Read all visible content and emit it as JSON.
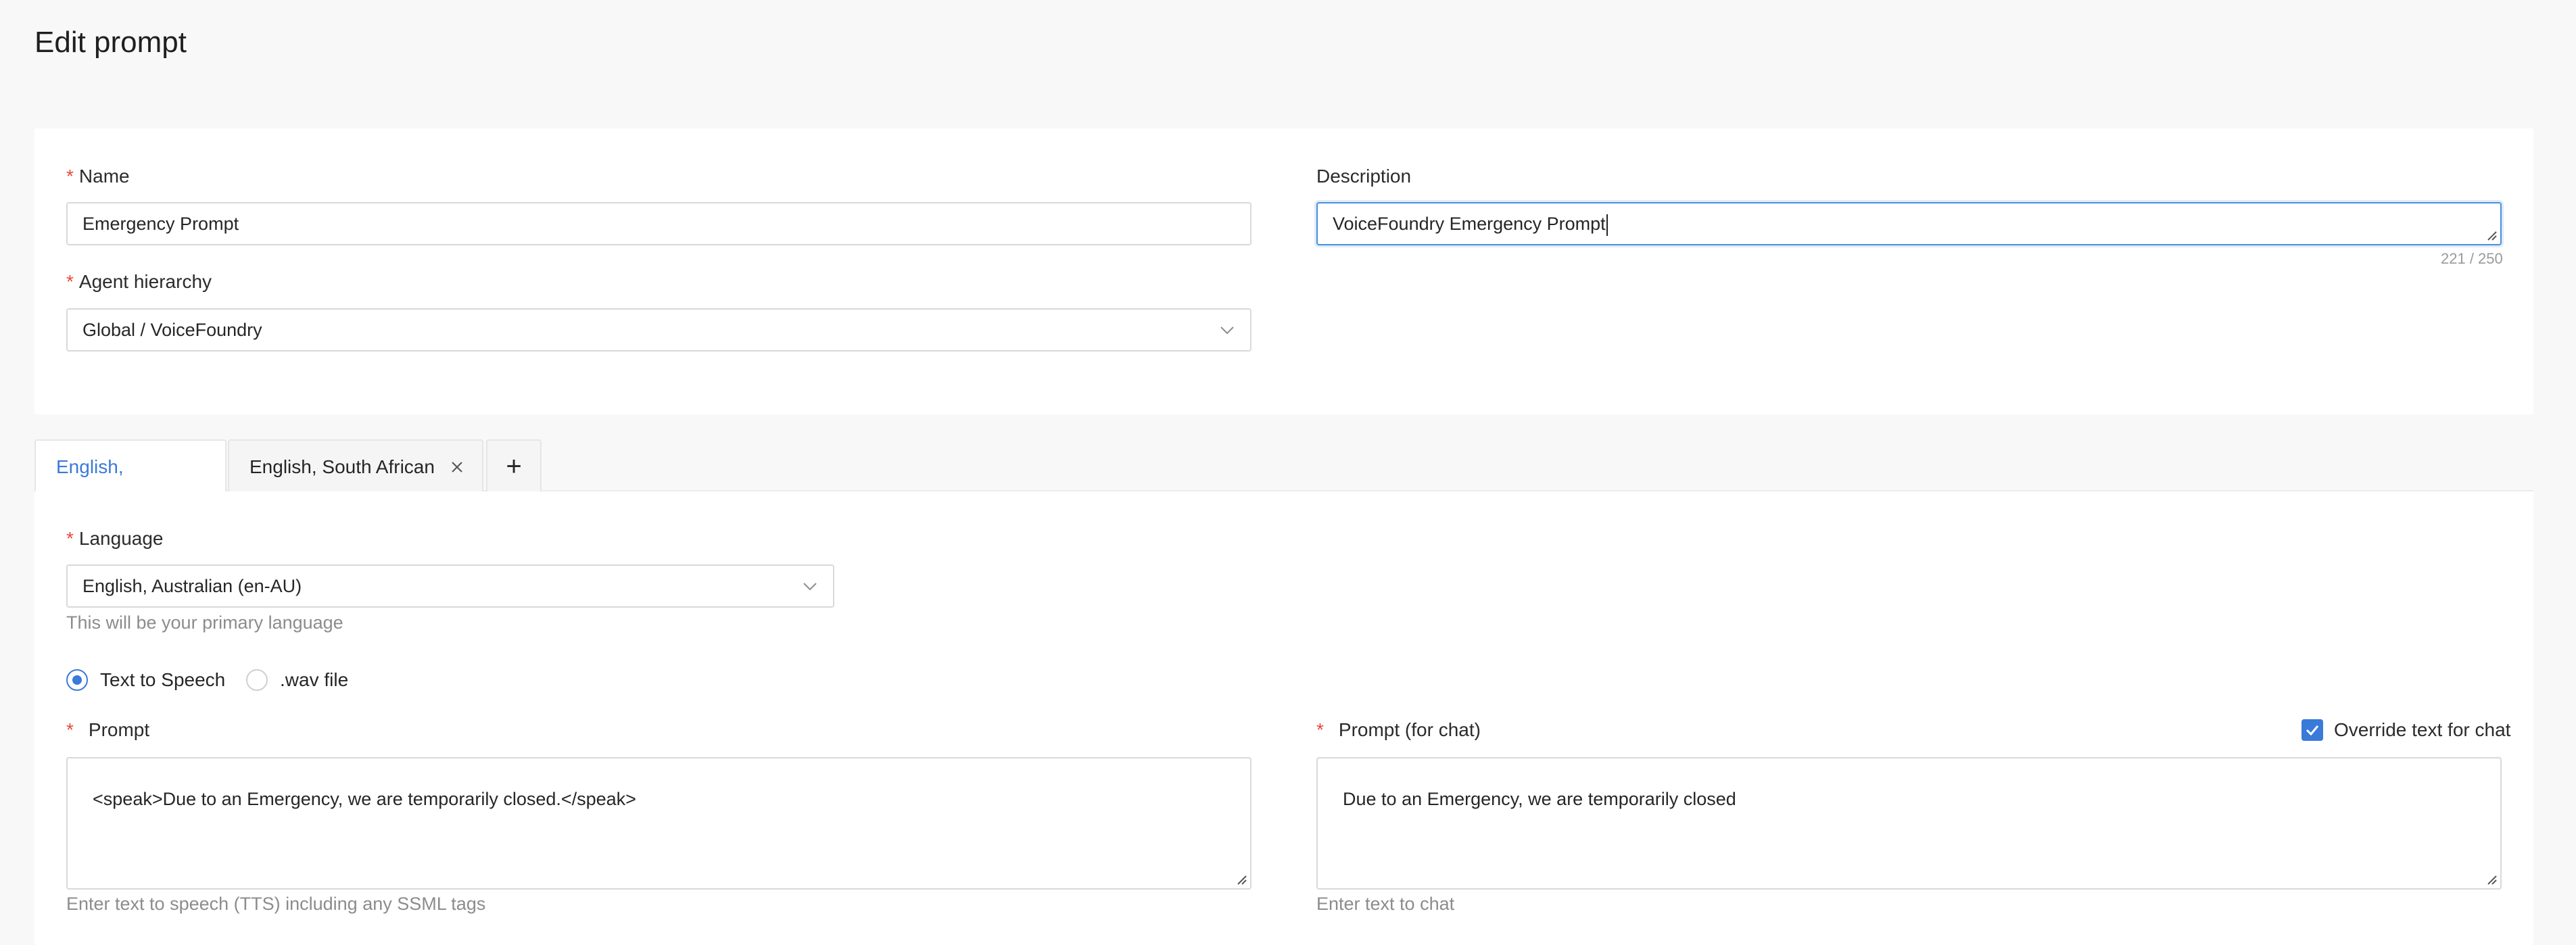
{
  "page": {
    "title": "Edit prompt"
  },
  "general": {
    "name": {
      "label": "Name",
      "value": "Emergency Prompt"
    },
    "description": {
      "label": "Description",
      "value": "VoiceFoundry Emergency Prompt",
      "counter": "221 / 250"
    },
    "hierarchy": {
      "label": "Agent hierarchy",
      "value": "Global / VoiceFoundry"
    },
    "required_marker": "*"
  },
  "tabs": [
    {
      "label": "English, Australian",
      "active": true
    },
    {
      "label": "English, South African",
      "active": false,
      "closable": true
    }
  ],
  "tab_add_label": "+",
  "language": {
    "label": "Language",
    "value": "English, Australian (en-AU)",
    "help": "This will be your primary language"
  },
  "prompt_type": {
    "options": [
      {
        "label": "Text to Speech",
        "checked": true
      },
      {
        "label": ".wav file",
        "checked": false
      }
    ]
  },
  "prompt": {
    "label": "Prompt",
    "value": "<speak>Due to an Emergency, we are temporarily closed.</speak>",
    "help": "Enter text to speech (TTS) including any SSML tags"
  },
  "prompt_chat": {
    "label": "Prompt (for chat)",
    "override_label": "Override text for chat",
    "override_checked": true,
    "value": "Due to an Emergency, we are temporarily closed",
    "help": "Enter text to chat"
  },
  "icons": {
    "select_chevron": "chevron-down-icon",
    "tab_close": "close-icon",
    "checkbox": "check-icon",
    "resize": "resize-grip-icon"
  },
  "colors": {
    "accent": "#3a7ad9",
    "required": "#e8483f",
    "focus_border": "#4a8fe0"
  }
}
